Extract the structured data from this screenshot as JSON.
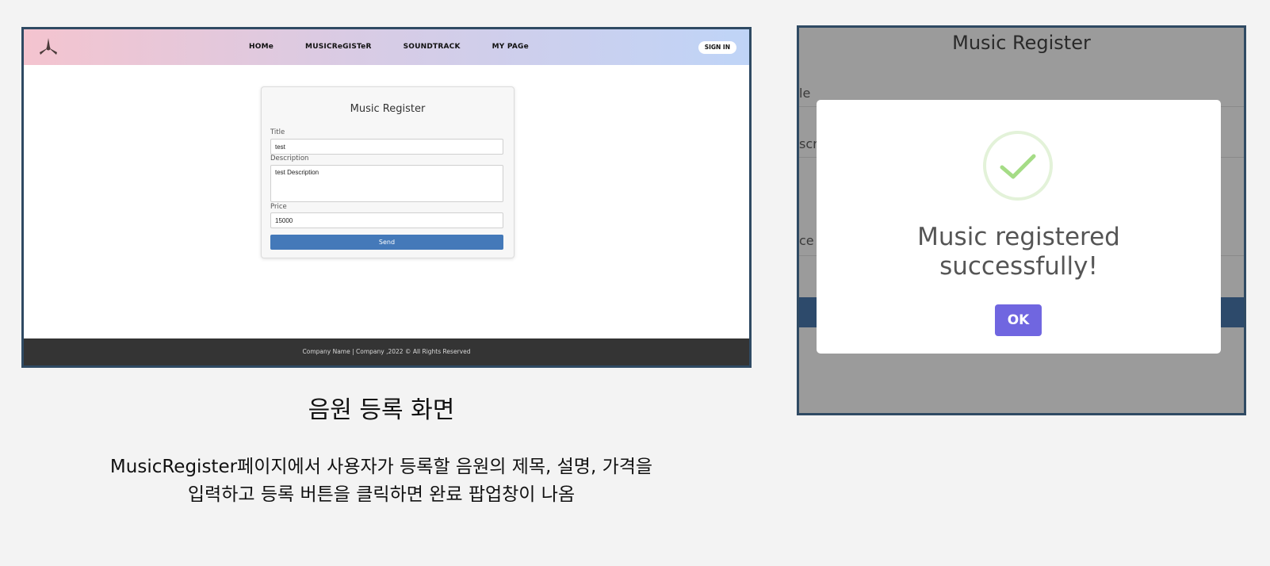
{
  "left_screen": {
    "nav": {
      "logo_icon": "propeller-logo-icon",
      "links": [
        "HOMe",
        "MUSICReGISTeR",
        "SOUNDTRACK",
        "MY PAGe"
      ],
      "signin_label": "SIGN IN"
    },
    "form": {
      "title": "Music Register",
      "title_label": "Title",
      "title_value": "test",
      "description_label": "Description",
      "description_value": "test Description",
      "price_label": "Price",
      "price_value": "15000",
      "send_label": "Send"
    },
    "footer_text": "Company Name | Company ,2022 © All Rights Reserved"
  },
  "captions": {
    "title": "음원 등록 화면",
    "description_line1": "MusicRegister페이지에서 사용자가 등록할 음원의 제목, 설명, 가격을",
    "description_line2": "입력하고 등록 버튼을 클릭하면 완료 팝업창이 나옴"
  },
  "right_screen": {
    "background_title": "Music Register",
    "background_labels": [
      "le",
      "scr",
      "ce"
    ],
    "modal": {
      "icon": "success-check-icon",
      "message_line1": "Music registered",
      "message_line2": "successfully!",
      "ok_label": "OK"
    }
  },
  "colors": {
    "frame_border": "#2f4a63",
    "send_button": "#4479b9",
    "ok_button": "#7066e0",
    "check_green": "#a5dc86",
    "footer": "#343434"
  }
}
